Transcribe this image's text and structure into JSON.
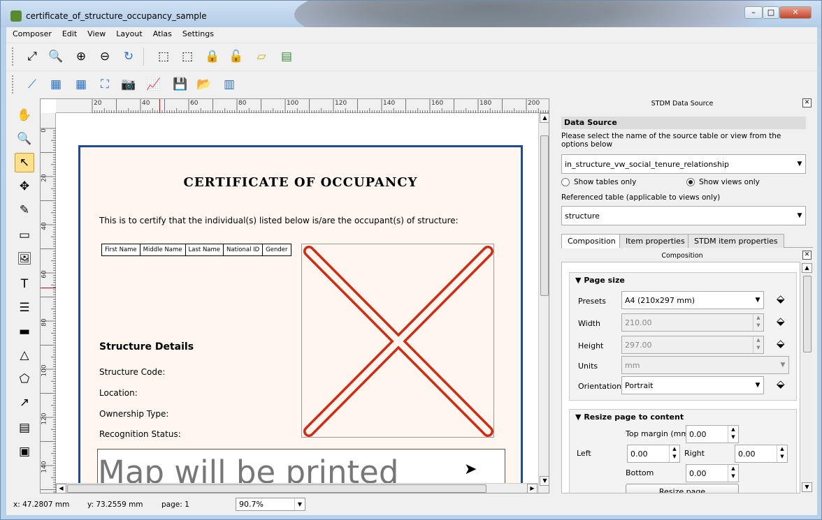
{
  "window": {
    "title": "certificate_of_structure_occupancy_sample",
    "min": "–",
    "max": "□",
    "close": "✕"
  },
  "menu": [
    "Composer",
    "Edit",
    "View",
    "Layout",
    "Atlas",
    "Settings"
  ],
  "ruler": {
    "h_labels": [
      "20",
      "40",
      "60",
      "80",
      "100",
      "120",
      "140",
      "160",
      "180",
      "200"
    ],
    "v_labels": [
      "0",
      "20",
      "40",
      "60",
      "80",
      "100",
      "120",
      "140"
    ]
  },
  "certificate": {
    "title": "CERTIFICATE OF OCCUPANCY",
    "intro": "This is to certify that the individual(s) listed below is/are the occupant(s) of structure:",
    "table_headers": [
      "First Name",
      "Middle Name",
      "Last Name",
      "National ID",
      "Gender"
    ],
    "details_title": "Structure Details",
    "fields": [
      "Structure Code:",
      "Location:",
      "Ownership Type:",
      "Recognition Status:"
    ],
    "map_text": "Map will be printed"
  },
  "status": {
    "x": "x: 47.2807 mm",
    "y": "y: 73.2559 mm",
    "page": "page: 1",
    "zoom": "90.7%"
  },
  "panel": {
    "title": "STDM Data Source",
    "data_source_label": "Data Source",
    "instruction": "Please select the name of the source table or view from the options below",
    "source_value": "in_structure_vw_social_tenure_relationship",
    "radio_tables": "Show tables only",
    "radio_views": "Show views only",
    "ref_label": "Referenced table (applicable to views only)",
    "ref_value": "structure",
    "tabs": [
      "Composition",
      "Item properties",
      "STDM item properties"
    ],
    "composition_title": "Composition",
    "page_size": {
      "title": "Page size",
      "presets_label": "Presets",
      "presets_value": "A4 (210x297 mm)",
      "width_label": "Width",
      "width_value": "210.00",
      "height_label": "Height",
      "height_value": "297.00",
      "units_label": "Units",
      "units_value": "mm",
      "orientation_label": "Orientation",
      "orientation_value": "Portrait"
    },
    "resize": {
      "title": "Resize page to content",
      "top_label": "Top margin (mm)",
      "top_value": "0.00",
      "left_label": "Left",
      "left_value": "0.00",
      "right_label": "Right",
      "right_value": "0.00",
      "bottom_label": "Bottom",
      "bottom_value": "0.00",
      "button": "Resize page"
    }
  },
  "colors": {
    "accent": "#1a4b9c",
    "x_mark": "#d42a12",
    "page_bg": "#fef6ef"
  }
}
